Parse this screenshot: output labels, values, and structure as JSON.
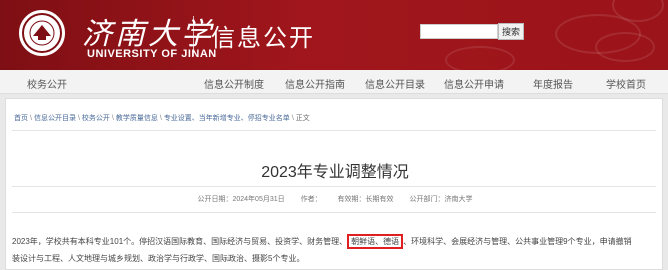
{
  "header": {
    "university_name_cn": "济南大学",
    "university_name_en": "UNIVERSITY OF JINAN",
    "section_title": "信息公开",
    "search_button": "搜索",
    "search_value": ""
  },
  "nav": {
    "items": [
      "校务公开",
      "信息公开制度",
      "信息公开指南",
      "信息公开目录",
      "信息公开申请",
      "年度报告",
      "学校首页"
    ]
  },
  "breadcrumb": {
    "items": [
      "首页",
      "信息公开目录",
      "校务公开",
      "教学质量信息",
      "专业设置、当年新增专业、停招专业名单",
      "正文"
    ],
    "separator": "\\"
  },
  "article": {
    "title": "2023年专业调整情况",
    "meta": {
      "publish_date": "公开日期：2024年05月31日",
      "author": "作者：",
      "validity": "有效期：长期有效",
      "department": "公开部门：济南大学"
    },
    "body_part1": "2023年，学校共有本科专业101个。停招汉语国际教育、国际经济与贸易、投资学、财务管理、",
    "body_highlight": "朝鲜语、德语",
    "body_part2": "、环境科学、会展经济与管理、公共事业管理9个专业，申请撤销",
    "body_line2": "装设计与工程、人文地理与城乡规划、政治学与行政学、国际政治、摄影5个专业。"
  },
  "colors": {
    "banner": "#9b1419",
    "highlight_border": "#e02020"
  }
}
